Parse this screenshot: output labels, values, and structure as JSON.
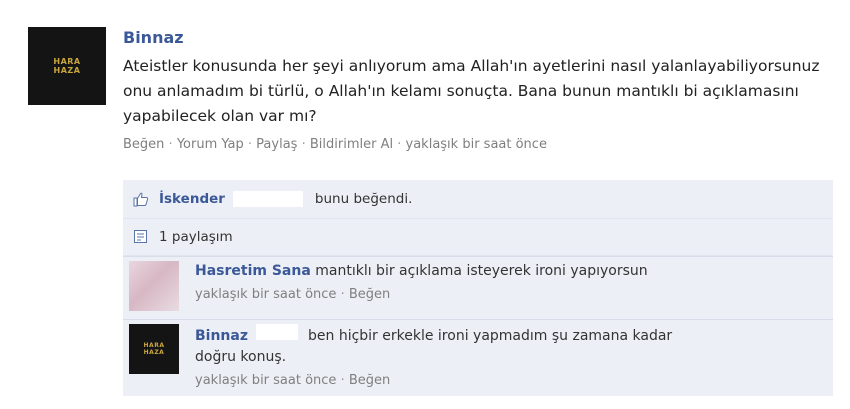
{
  "post": {
    "author": "Binnaz",
    "avatar_text": "HARA\nHAZA",
    "text": "Ateistler konusunda her şeyi anlıyorum ama Allah'ın ayetlerini nasıl yalanlayabiliyorsunuz onu anlamadım bi türlü, o Allah'ın kelamı sonuçta. Bana bunun mantıklı bi açıklamasını yapabilecek olan var mı?",
    "actions": {
      "like": "Beğen",
      "comment": "Yorum Yap",
      "share": "Paylaş",
      "notify": "Bildirimler Al",
      "time": "yaklaşık bir saat önce",
      "separator": "·"
    }
  },
  "likes": {
    "user": "İskender",
    "text": "bunu beğendi."
  },
  "shares": {
    "text": "1 paylaşım"
  },
  "comments": [
    {
      "author": "Hasretim Sana",
      "text": "mantıklı bir açıklama isteyerek ironi yapıyorsun",
      "time": "yaklaşık bir saat önce",
      "like": "Beğen"
    },
    {
      "author": "Binnaz",
      "text": "ben hiçbir erkekle ironi yapmadım şu zamana kadar doğru konuş.",
      "time": "yaklaşık bir saat önce",
      "like": "Beğen"
    }
  ],
  "colors": {
    "link": "#3b5998",
    "meta": "#7f7f7f",
    "feedback_bg": "#eceff5"
  },
  "icons": [
    "thumbs-up-icon",
    "share-icon"
  ]
}
